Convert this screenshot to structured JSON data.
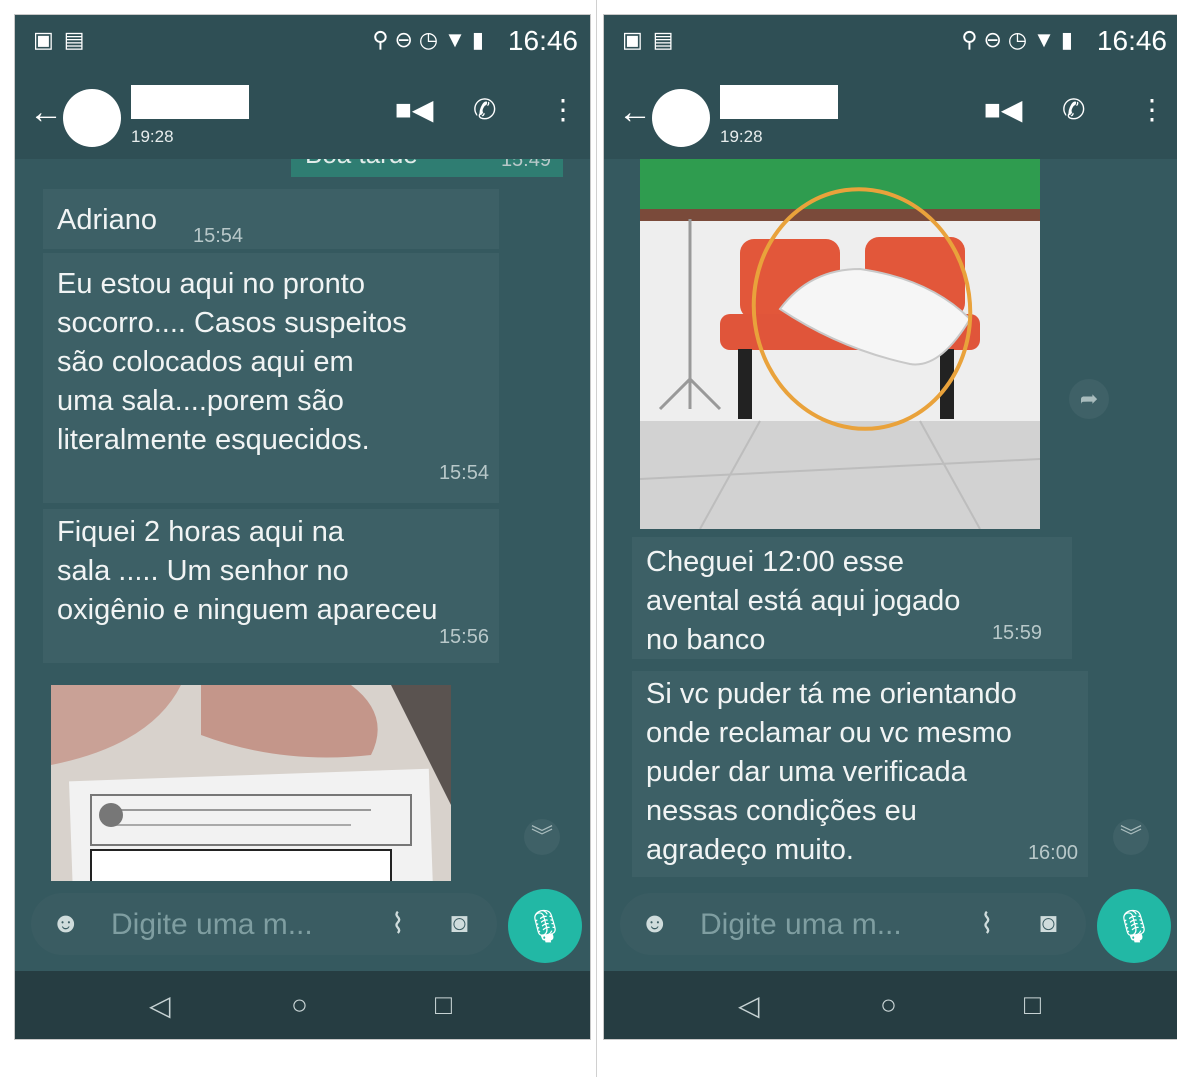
{
  "status_bar": {
    "time": "16:46"
  },
  "header": {
    "last_seen": "19:28"
  },
  "left_chat": {
    "cutoff_text": "Boa tarde",
    "cutoff_time": "15:49",
    "messages": [
      {
        "text": "Adriano",
        "time": "15:54"
      },
      {
        "lines": [
          "Eu estou aqui no pronto",
          "socorro.... Casos suspeitos",
          "são colocados aqui em",
          "uma sala....porem são",
          "literalmente esquecidos."
        ],
        "time": "15:54"
      },
      {
        "lines": [
          "Fiquei 2 horas aqui na",
          "sala ..... Um senhor no",
          "oxigênio e ninguem apareceu"
        ],
        "time": "15:56"
      }
    ]
  },
  "right_chat": {
    "messages": [
      {
        "lines": [
          "Cheguei 12:00 esse",
          "avental está aqui jogado",
          "no banco"
        ],
        "time": "15:59"
      },
      {
        "lines": [
          "Si vc puder tá me orientando",
          "onde reclamar ou vc mesmo",
          "puder dar uma verificada",
          "nessas condições eu",
          "agradeço muito."
        ],
        "time": "16:00"
      }
    ]
  },
  "input": {
    "placeholder": "Digite uma m..."
  },
  "icons": {
    "back": "arrow-left-icon",
    "video": "video-camera-icon",
    "call": "phone-icon",
    "menu": "more-vertical-icon",
    "emoji": "emoji-icon",
    "attach": "paperclip-icon",
    "camera": "camera-icon",
    "mic": "microphone-icon",
    "forward": "forward-arrow-icon",
    "scroll": "double-chevron-down-icon"
  },
  "colors": {
    "chat_bg": "#35595f",
    "header_bg": "#2f4f55",
    "accent": "#22b8a5",
    "bubble": "#3d6066"
  }
}
